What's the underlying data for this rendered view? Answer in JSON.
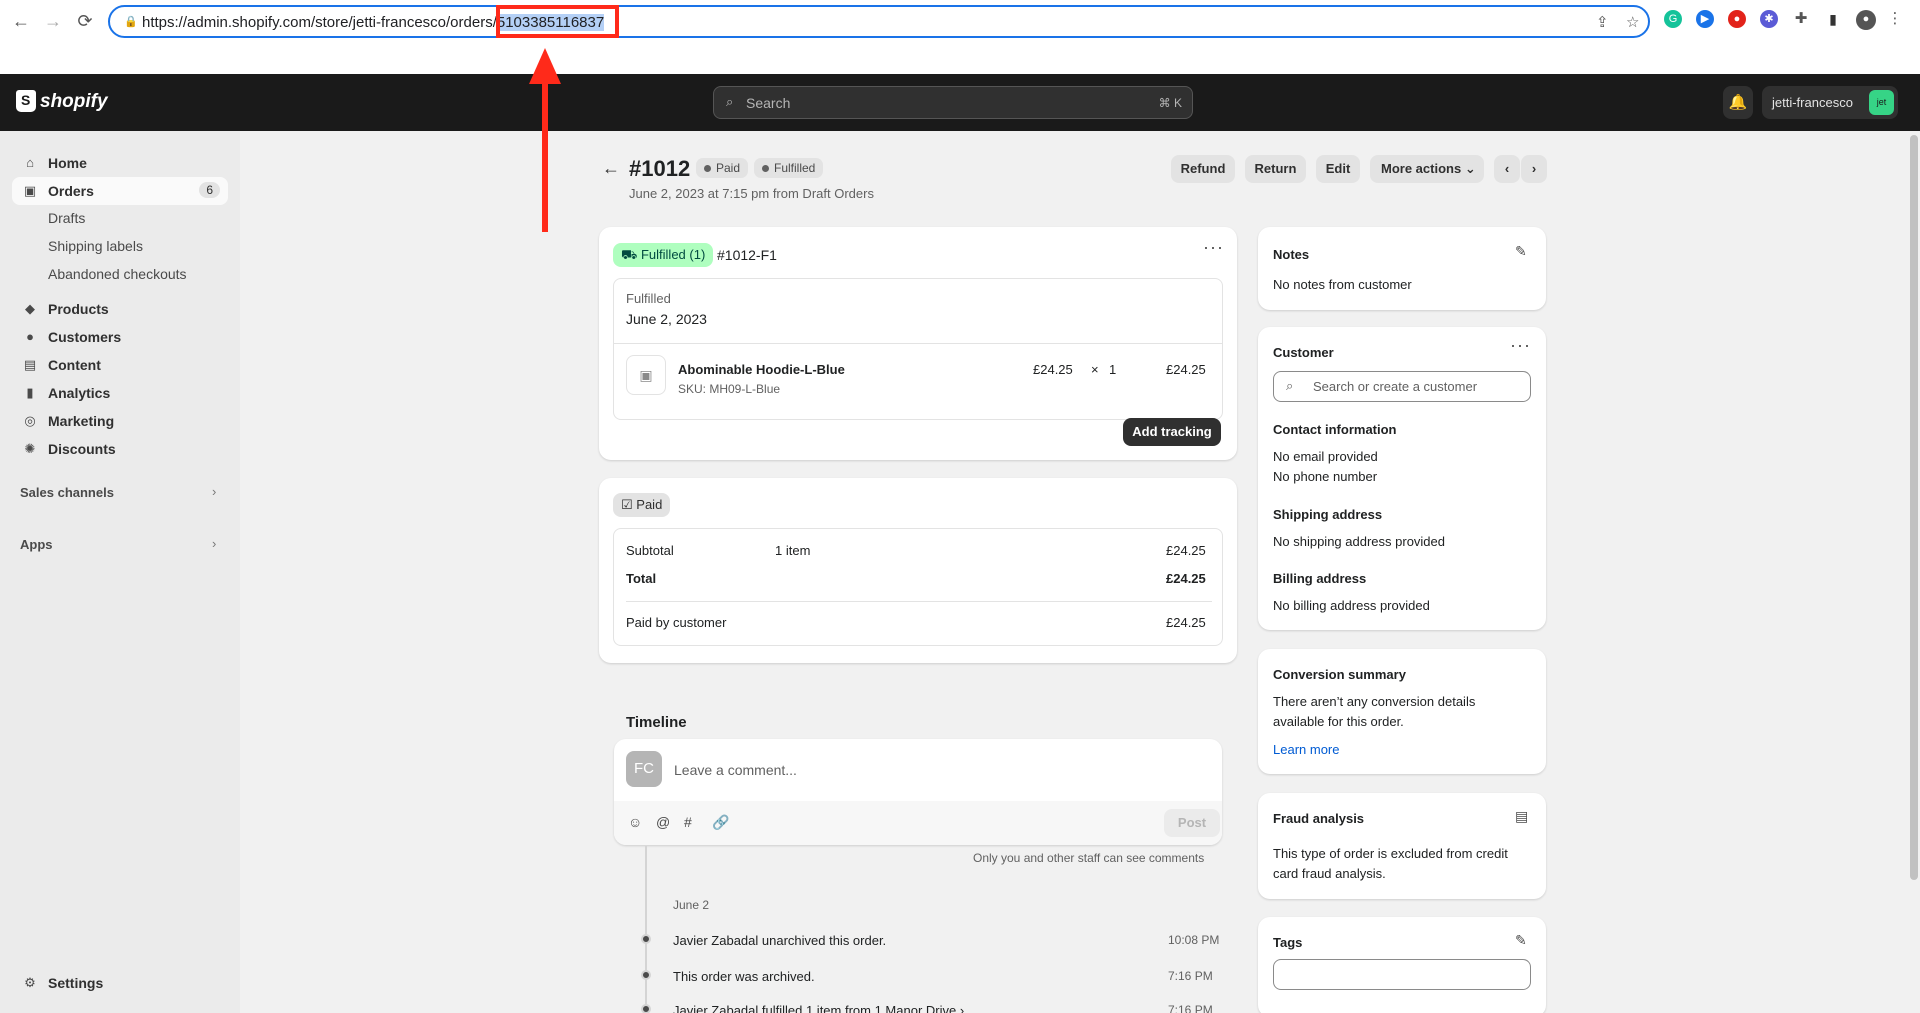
{
  "browser": {
    "url_prefix": "https://admin.shopify.com/store/jetti-francesco/orders/",
    "url_selected": "5103385116837",
    "back": "←",
    "forward": "→",
    "reload": "⟳"
  },
  "topbar": {
    "logo_text": "shopify",
    "search_placeholder": "Search",
    "search_shortcut": "⌘ K",
    "store_name": "jetti-francesco",
    "store_avatar": "jet"
  },
  "sidebar": {
    "items": [
      {
        "label": "Home",
        "icon": "home-icon"
      },
      {
        "label": "Orders",
        "icon": "orders-icon",
        "badge": "6"
      },
      {
        "label": "Products",
        "icon": "tag-icon"
      },
      {
        "label": "Customers",
        "icon": "person-icon"
      },
      {
        "label": "Content",
        "icon": "content-icon"
      },
      {
        "label": "Analytics",
        "icon": "bar-chart-icon"
      },
      {
        "label": "Marketing",
        "icon": "target-icon"
      },
      {
        "label": "Discounts",
        "icon": "discount-icon"
      }
    ],
    "order_subitems": [
      "Drafts",
      "Shipping labels",
      "Abandoned checkouts"
    ],
    "sales_channels": "Sales channels",
    "apps": "Apps",
    "settings": "Settings"
  },
  "order": {
    "title": "#1012",
    "badge_paid": "Paid",
    "badge_fulfilled": "Fulfilled",
    "subtitle": "June 2, 2023 at 7:15 pm from Draft Orders",
    "actions": [
      "Refund",
      "Return",
      "Edit",
      "More actions"
    ]
  },
  "fulfillment": {
    "status": "Fulfilled (1)",
    "id": "#1012-F1",
    "label": "Fulfilled",
    "date": "June 2, 2023",
    "item_name": "Abominable Hoodie-L-Blue",
    "sku": "SKU: MH09-L-Blue",
    "unit_price": "£24.25",
    "times": "×",
    "qty": "1",
    "line_total": "£24.25",
    "add_tracking": "Add tracking"
  },
  "payment": {
    "status": "Paid",
    "subtotal_label": "Subtotal",
    "subtotal_items": "1 item",
    "subtotal_value": "£24.25",
    "total_label": "Total",
    "total_value": "£24.25",
    "paid_label": "Paid by customer",
    "paid_value": "£24.25"
  },
  "timeline": {
    "title": "Timeline",
    "avatar": "FC",
    "comment_placeholder": "Leave a comment...",
    "post": "Post",
    "note": "Only you and other staff can see comments",
    "date_group": "June 2",
    "events": [
      {
        "text": "Javier Zabadal unarchived this order.",
        "time": "10:08 PM"
      },
      {
        "text": "This order was archived.",
        "time": "7:16 PM"
      },
      {
        "text": "Javier Zabadal fulfilled 1 item from 1 Manor Drive",
        "time": "7:16 PM"
      }
    ]
  },
  "notes": {
    "title": "Notes",
    "text": "No notes from customer"
  },
  "customer": {
    "title": "Customer",
    "search_placeholder": "Search or create a customer",
    "contact_title": "Contact information",
    "no_email": "No email provided",
    "no_phone": "No phone number",
    "shipping_title": "Shipping address",
    "shipping_text": "No shipping address provided",
    "billing_title": "Billing address",
    "billing_text": "No billing address provided"
  },
  "conversion": {
    "title": "Conversion summary",
    "line1": "There aren’t any conversion details",
    "line2": "available for this order.",
    "link": "Learn more"
  },
  "fraud": {
    "title": "Fraud analysis",
    "line1": "This type of order is excluded from credit",
    "line2": "card fraud analysis."
  },
  "tags": {
    "title": "Tags"
  },
  "colors": {
    "annotation": "#ff2a1a",
    "fulfilled_bg": "#affebf",
    "fulfilled_text": "#014b40"
  }
}
